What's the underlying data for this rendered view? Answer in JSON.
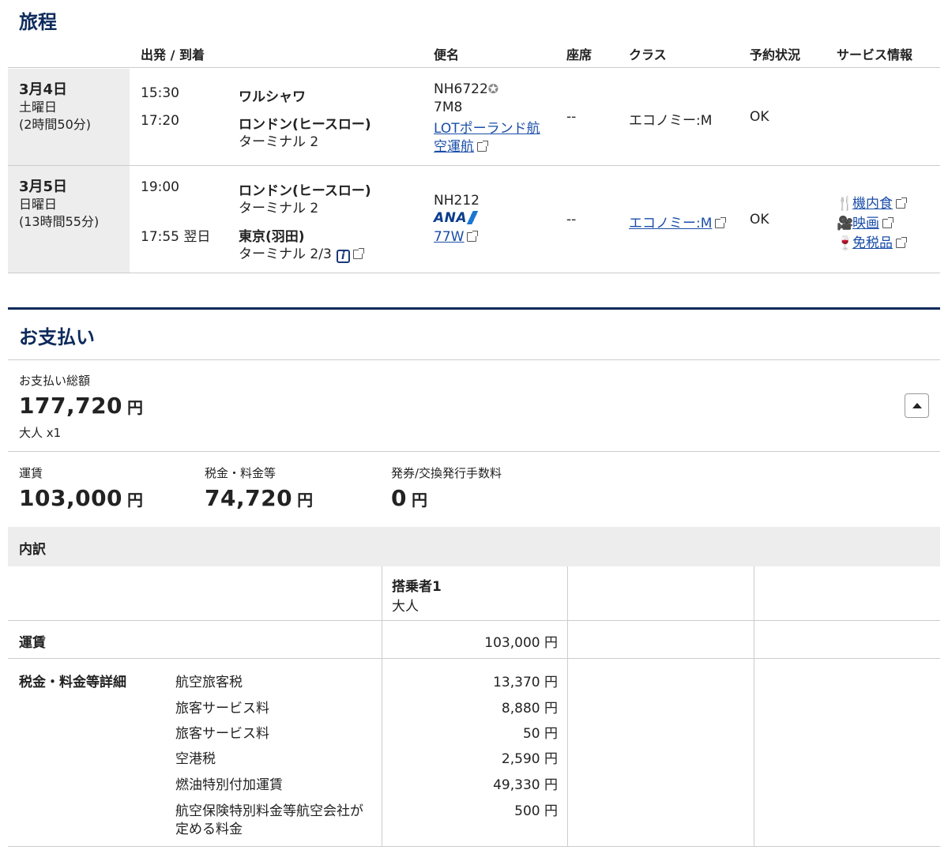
{
  "itinerary": {
    "title": "旅程",
    "headers": {
      "depart_arrive": "出発 / 到着",
      "flight": "便名",
      "seat": "座席",
      "class": "クラス",
      "status": "予約状況",
      "service": "サービス情報"
    },
    "flights": [
      {
        "date": "3月4日",
        "weekday": "土曜日",
        "duration": "(2時間50分)",
        "dep_time": "15:30",
        "dep_city": "ワルシャワ",
        "arr_time": "17:20",
        "arr_city": "ロンドン(ヒースロー)",
        "arr_terminal": "ターミナル 2",
        "flight_no": "NH6722",
        "aircraft": "7M8",
        "operator_line1": "LOTポーランド航",
        "operator_line2": "空運航",
        "seat": "--",
        "class": "エコノミー:M",
        "status": "OK"
      },
      {
        "date": "3月5日",
        "weekday": "日曜日",
        "duration": "(13時間55分)",
        "dep_time": "19:00",
        "dep_city": "ロンドン(ヒースロー)",
        "dep_terminal": "ターミナル 2",
        "arr_time": "17:55 翌日",
        "arr_city": "東京(羽田)",
        "arr_terminal": "ターミナル 2/3",
        "flight_no": "NH212",
        "airline_logo": "ANA",
        "aircraft": "77W",
        "seat": "--",
        "class": "エコノミー:M",
        "status": "OK",
        "services": [
          "機内食",
          "映画",
          "免税品"
        ]
      }
    ]
  },
  "payment": {
    "title": "お支払い",
    "total_label": "お支払い総額",
    "total_amount": "177,720",
    "yen": "円",
    "passengers": "大人 x1",
    "fare_label": "運賃",
    "fare_amount": "103,000",
    "tax_label": "税金・料金等",
    "tax_amount": "74,720",
    "fee_label": "発券/交換発行手数料",
    "fee_amount": "0",
    "breakdown_title": "内訳",
    "passenger_header": "搭乗者1",
    "passenger_type": "大人",
    "fare_row_label": "運賃",
    "fare_row_amount": "103,000 円",
    "tax_detail_label": "税金・料金等詳細",
    "tax_items": [
      {
        "name": "航空旅客税",
        "amount": "13,370 円"
      },
      {
        "name": "旅客サービス料",
        "amount": "8,880 円"
      },
      {
        "name": "旅客サービス料",
        "amount": "50 円"
      },
      {
        "name": "空港税",
        "amount": "2,590 円"
      },
      {
        "name": "燃油特別付加運賃",
        "amount": "49,330 円"
      },
      {
        "name": "航空保険特別料金等航空会社が",
        "name2": "定める料金",
        "amount": "500 円"
      }
    ]
  }
}
